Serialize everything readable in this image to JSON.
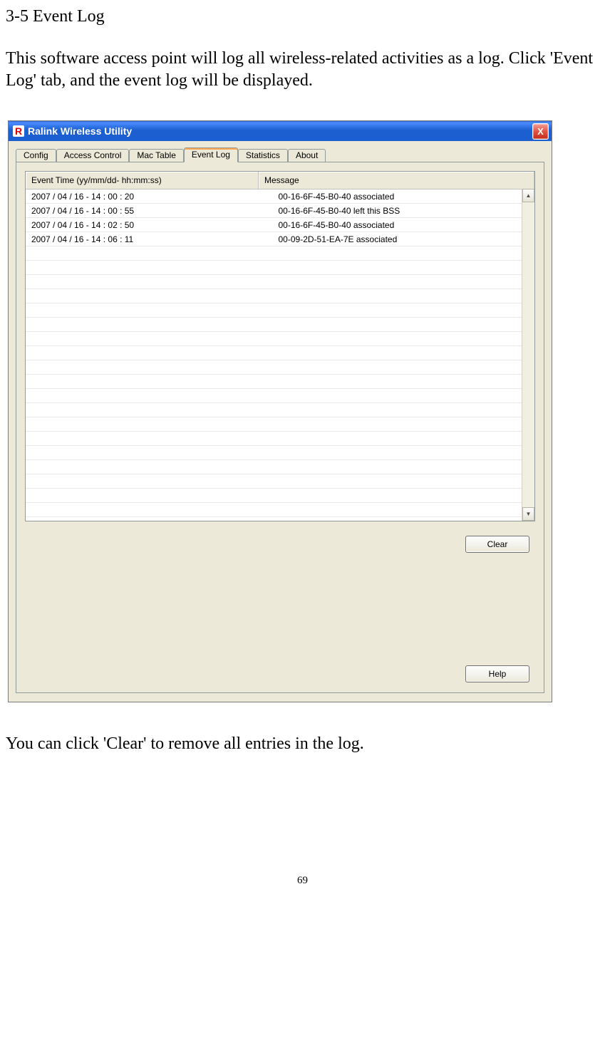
{
  "doc": {
    "section_title": "3-5 Event Log",
    "intro_line1": "This software access point will log all wireless-related activities as a log.",
    "intro_line2": "Click 'Event Log' tab, and the event log will be displayed.",
    "after_text": "You can click 'Clear' to remove all entries in the log.",
    "page_number": "69"
  },
  "window": {
    "title": "Ralink Wireless Utility",
    "close_glyph": "X",
    "app_icon": "R",
    "tabs": {
      "config": "Config",
      "access_control": "Access Control",
      "mac_table": "Mac Table",
      "event_log": "Event Log",
      "statistics": "Statistics",
      "about": "About"
    },
    "table": {
      "col_time": "Event Time (yy/mm/dd- hh:mm:ss)",
      "col_message": "Message",
      "rows": [
        {
          "time": "2007 / 04 / 16 - 14 : 00 : 20",
          "message": "00-16-6F-45-B0-40 associated"
        },
        {
          "time": "2007 / 04 / 16 - 14 : 00 : 55",
          "message": "00-16-6F-45-B0-40 left this BSS"
        },
        {
          "time": "2007 / 04 / 16 - 14 : 02 : 50",
          "message": "00-16-6F-45-B0-40 associated"
        },
        {
          "time": "2007 / 04 / 16 - 14 : 06 : 11",
          "message": "00-09-2D-51-EA-7E associated"
        }
      ]
    },
    "buttons": {
      "clear": "Clear",
      "help": "Help"
    },
    "scroll_up": "▲",
    "scroll_down": "▼"
  }
}
